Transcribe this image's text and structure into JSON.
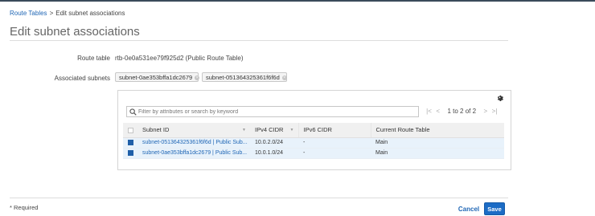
{
  "breadcrumb": {
    "parent": "Route Tables",
    "separator": ">",
    "current": "Edit subnet associations"
  },
  "page": {
    "title": "Edit subnet associations"
  },
  "route_table": {
    "label": "Route table",
    "value": "rtb-0e0a531ee79f925d2 (Public Route Table)"
  },
  "associated_subnets": {
    "label": "Associated subnets",
    "chips": [
      {
        "label": "subnet-0ae353bffa1dc2679"
      },
      {
        "label": "subnet-051364325361f6f6d"
      }
    ]
  },
  "filter": {
    "placeholder": "Filter by attributes or search by keyword",
    "value": ""
  },
  "pagination": {
    "text": "1 to 2 of 2"
  },
  "table": {
    "headers": {
      "subnet_id": "Subnet ID",
      "ipv4": "IPv4 CIDR",
      "ipv6": "IPv6 CIDR",
      "route_table": "Current Route Table"
    },
    "rows": [
      {
        "selected": true,
        "subnet": "subnet-051364325361f6f6d | Public Sub...",
        "ipv4": "10.0.2.0/24",
        "ipv6": "-",
        "route_table": "Main"
      },
      {
        "selected": true,
        "subnet": "subnet-0ae353bffa1dc2679 | Public Sub...",
        "ipv4": "10.0.1.0/24",
        "ipv6": "-",
        "route_table": "Main"
      }
    ]
  },
  "footer": {
    "required_note": "* Required",
    "cancel_label": "Cancel",
    "save_label": "Save"
  },
  "colors": {
    "link": "#1f66b5",
    "primary_button": "#1c6cc5",
    "selected_row": "#e8f2fb",
    "checkbox_checked": "#1f5fa8"
  },
  "icons": {
    "gear": "gear-icon",
    "search": "search-icon",
    "first_page": "first-page-icon",
    "prev_page": "prev-page-icon",
    "next_page": "next-page-icon",
    "last_page": "last-page-icon",
    "chip_remove": "remove-chip-icon"
  }
}
